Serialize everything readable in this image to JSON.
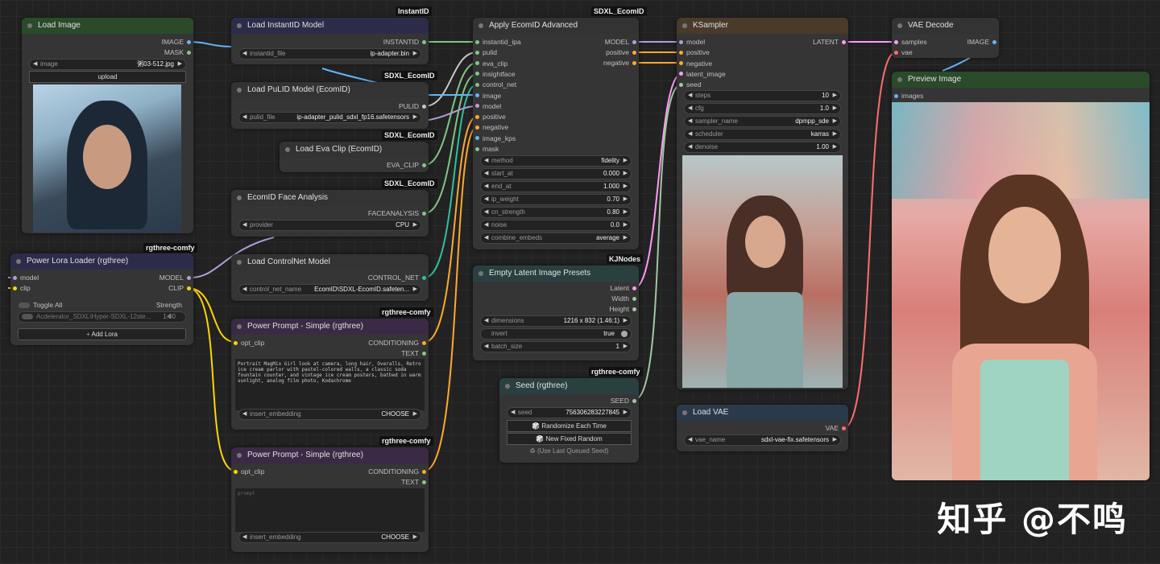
{
  "badges": {
    "instantid": "InstantID",
    "sdxl1": "SDXL_EcomID",
    "sdxl2": "SDXL_EcomID",
    "sdxl3": "SDXL_EcomID",
    "sdxl4": "SDXL_EcomID",
    "rg1": "rgthree-comfy",
    "rg2": "rgthree-comfy",
    "rg3": "rgthree-comfy",
    "rg4": "rgthree-comfy",
    "kj": "KJNodes"
  },
  "load_image": {
    "title": "Load Image",
    "out_image": "IMAGE",
    "out_mask": "MASK",
    "image_label": "image",
    "image_value": "粥03-512.jpg",
    "upload": "upload"
  },
  "load_instantid": {
    "title": "Load InstantID Model",
    "out": "INSTANTID",
    "w_label": "instantid_file",
    "w_value": "ip-adapter.bin"
  },
  "load_pulid": {
    "title": "Load PuLID Model (EcomID)",
    "out": "PULID",
    "w_label": "pulid_file",
    "w_value": "ip-adapter_pulid_sdxl_fp16.safetensors"
  },
  "load_eva": {
    "title": "Load Eva Clip (EcomID)",
    "out": "EVA_CLIP"
  },
  "face_analysis": {
    "title": "EcomID Face Analysis",
    "out": "FACEANALYSIS",
    "w_label": "provider",
    "w_value": "CPU"
  },
  "power_lora": {
    "title": "Power Lora Loader (rgthree)",
    "in_model": "model",
    "in_clip": "clip",
    "out_model": "MODEL",
    "out_clip": "CLIP",
    "toggle": "Toggle All",
    "strength": "Strength",
    "lora_name": "Acdelerator_SDXL\\Hyper-SDXL-12ste...",
    "lora_strength": "1.00",
    "add": "Add Lora"
  },
  "controlnet": {
    "title": "Load ControlNet Model",
    "out": "CONTROL_NET",
    "w_label": "control_net_name",
    "w_value": "EcomID\\SDXL-EcomID.safeten..."
  },
  "prompt1": {
    "title": "Power Prompt - Simple (rgthree)",
    "in": "opt_clip",
    "out1": "CONDITIONING",
    "out2": "TEXT",
    "text": "Portrait MagMix Girl look at camera, long hair, Overalls, Retro ice cream parlor with pastel-colored walls, a classic soda fountain counter, and vintage ice cream posters, bathed in warm sunlight, analog film photo, Kodachrome",
    "w_label": "insert_embedding",
    "w_value": "CHOOSE"
  },
  "prompt2": {
    "title": "Power Prompt - Simple (rgthree)",
    "in": "opt_clip",
    "out1": "CONDITIONING",
    "out2": "TEXT",
    "placeholder": "prompt",
    "w_label": "insert_embedding",
    "w_value": "CHOOSE"
  },
  "apply_ecomid": {
    "title": "Apply EcomID Advanced",
    "inputs": [
      "instantid_ipa",
      "pulid",
      "eva_clip",
      "insightface",
      "control_net",
      "image",
      "model",
      "positive",
      "negative",
      "image_kps",
      "mask"
    ],
    "out_model": "MODEL",
    "out_pos": "positive",
    "out_neg": "negative",
    "widgets": [
      {
        "label": "method",
        "value": "fidelity"
      },
      {
        "label": "start_at",
        "value": "0.000"
      },
      {
        "label": "end_at",
        "value": "1.000"
      },
      {
        "label": "ip_weight",
        "value": "0.70"
      },
      {
        "label": "cn_strength",
        "value": "0.80"
      },
      {
        "label": "noise",
        "value": "0.0"
      },
      {
        "label": "combine_embeds",
        "value": "average"
      }
    ]
  },
  "latent_presets": {
    "title": "Empty Latent Image Presets",
    "out1": "Latent",
    "out2": "Width",
    "out3": "Height",
    "dims_label": "dimensions",
    "dims_value": "1216 x 832 (1.46:1)",
    "invert_label": "invert",
    "invert_value": "true",
    "batch_label": "batch_size",
    "batch_value": "1"
  },
  "seed": {
    "title": "Seed (rgthree)",
    "out": "SEED",
    "seed_label": "seed",
    "seed_value": "756306283227845",
    "btn1": "🎲 Randomize Each Time",
    "btn2": "🎲 New Fixed Random",
    "btn3": "♻ (Use Last Queued Seed)"
  },
  "ksampler": {
    "title": "KSampler",
    "inputs": [
      "model",
      "positive",
      "negative",
      "latent_image",
      "seed"
    ],
    "out": "LATENT",
    "widgets": [
      {
        "label": "steps",
        "value": "10"
      },
      {
        "label": "cfg",
        "value": "1.0"
      },
      {
        "label": "sampler_name",
        "value": "dpmpp_sde"
      },
      {
        "label": "scheduler",
        "value": "karras"
      },
      {
        "label": "denoise",
        "value": "1.00"
      }
    ]
  },
  "vae_decode": {
    "title": "VAE Decode",
    "in1": "samples",
    "in2": "vae",
    "out": "IMAGE"
  },
  "load_vae": {
    "title": "Load VAE",
    "out": "VAE",
    "w_label": "vae_name",
    "w_value": "sdxl-vae-fix.safetensors"
  },
  "preview": {
    "title": "Preview Image",
    "in": "images"
  },
  "watermark": "知乎 @不鸣",
  "colors": {
    "image": "#64b5f6",
    "mask": "#81c784",
    "model": "#b39ddb",
    "clip": "#ffd500",
    "cond": "#ffa931",
    "latent": "#ff9cf9",
    "vae": "#ff6e6e",
    "int": "#a0c8a0"
  }
}
